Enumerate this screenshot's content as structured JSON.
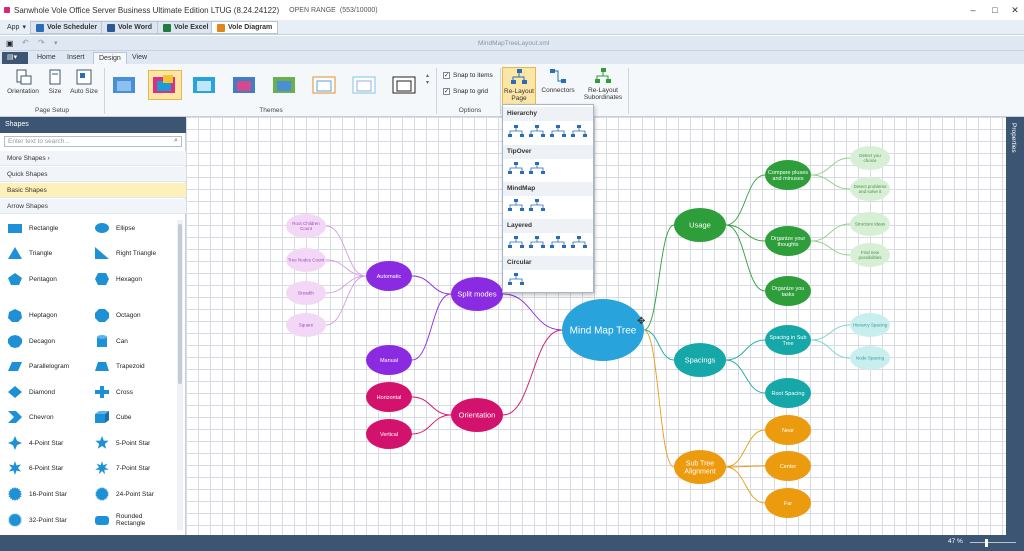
{
  "window": {
    "title": "Sanwhole Vole Office Server Business Ultimate Edition LTUG (8.24.24122)",
    "license": "OPEN RANGE",
    "count": "(553/10000)"
  },
  "app_menu": "App",
  "app_tabs": [
    "Vole Scheduler",
    "Vole Word",
    "Vole Excel",
    "Vole Diagram"
  ],
  "document": {
    "name": "MindMapTreeLayout.xml"
  },
  "ribbon_tabs": [
    "Home",
    "Insert",
    "Design",
    "View"
  ],
  "ribbon": {
    "orientation": "Orientation",
    "size": "Size",
    "auto_size": "Auto Size",
    "page_setup": "Page Setup",
    "themes": "Themes",
    "snap_items": "Snap to items",
    "snap_grid": "Snap to grid",
    "options": "Options",
    "relayout_page": "Re-Layout Page",
    "connectors": "Connectors",
    "relayout_subs": "Re-Layout Subordinates"
  },
  "shapes_panel": {
    "title": "Shapes",
    "search_placeholder": "Enter text to search...",
    "categories": [
      "More Shapes",
      "Quick Shapes",
      "Basic Shapes",
      "Arrow Shapes"
    ],
    "items": [
      "Rectangle",
      "Ellipse",
      "Triangle",
      "Right Triangle",
      "Pentagon",
      "Hexagon",
      "Heptagon",
      "Octagon",
      "Decagon",
      "Can",
      "Parallelogram",
      "Trapezoid",
      "Diamond",
      "Cross",
      "Chevron",
      "Cube",
      "4-Point Star",
      "5-Point Star",
      "6-Point Star",
      "7-Point Star",
      "16-Point Star",
      "24-Point Star",
      "32-Point Star",
      "Rounded Rectangle"
    ]
  },
  "dropdown": {
    "sections": [
      "Hierarchy",
      "TipOver",
      "MindMap",
      "Layered",
      "Circular"
    ]
  },
  "properties_tab": "Properties",
  "status": {
    "zoom": "47 %"
  },
  "colors": {
    "accent": "#3c5572",
    "root": "#29a3dc",
    "usage": "#2e9e3a",
    "split": "#8a2be2",
    "orientation": "#d3126e",
    "spacings": "#16a8a8",
    "subtree": "#ec9a0e"
  },
  "mindmap": {
    "root": "Mind Map Tree",
    "usage": "Usage",
    "usage_children": [
      "Compare pluses and minuses",
      "Organize your thoughts",
      "Organize you tasks"
    ],
    "usage_leaves": [
      "Detect you choice",
      "Detect problems and solve it",
      "Structure ideas",
      "Find new possibilities"
    ],
    "split": "Split modes",
    "split_children": [
      "Automatic",
      "Manual"
    ],
    "split_leaves": [
      "Root Children Count",
      "Tree Nodes Count",
      "Breadth",
      "Square"
    ],
    "orientation": "Orientation",
    "orientation_children": [
      "Horizontal",
      "Vertical"
    ],
    "spacings": "Spacings",
    "spacings_children": [
      "Spacing in Sub Tree",
      "Root Spacing"
    ],
    "spacings_leaves": [
      "Hierarcy Spacing",
      "Node Spacing"
    ],
    "subtree": "Sub Tree Alignment",
    "subtree_children": [
      "Near",
      "Center",
      "Far"
    ]
  }
}
